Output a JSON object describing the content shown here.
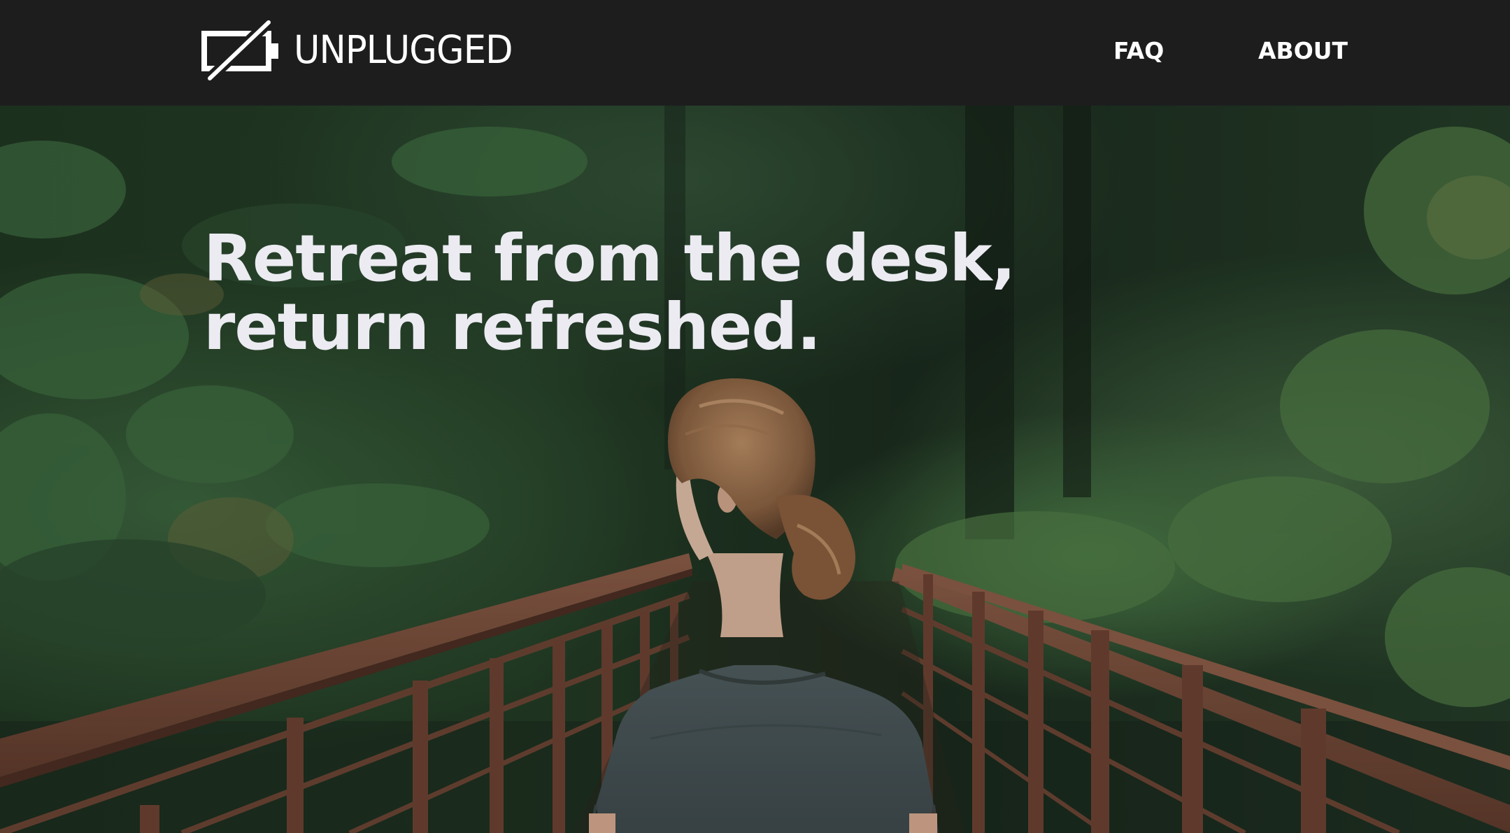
{
  "header": {
    "brand": {
      "icon": "battery-off-icon",
      "name": "UNPLUGGED"
    },
    "nav": [
      {
        "label": "FAQ"
      },
      {
        "label": "ABOUT"
      }
    ]
  },
  "hero": {
    "headline_line1": "Retreat from the desk,",
    "headline_line2": "return refreshed.",
    "image": "woman-on-forest-bridge-photo"
  },
  "colors": {
    "header_bg": "#1d1d1e",
    "header_text": "#ffffff",
    "headline_text": "#ecebf2",
    "forest_green": "#2f4a2f",
    "bridge_rust": "#7a4a38",
    "shirt_gray": "#4a5558"
  }
}
